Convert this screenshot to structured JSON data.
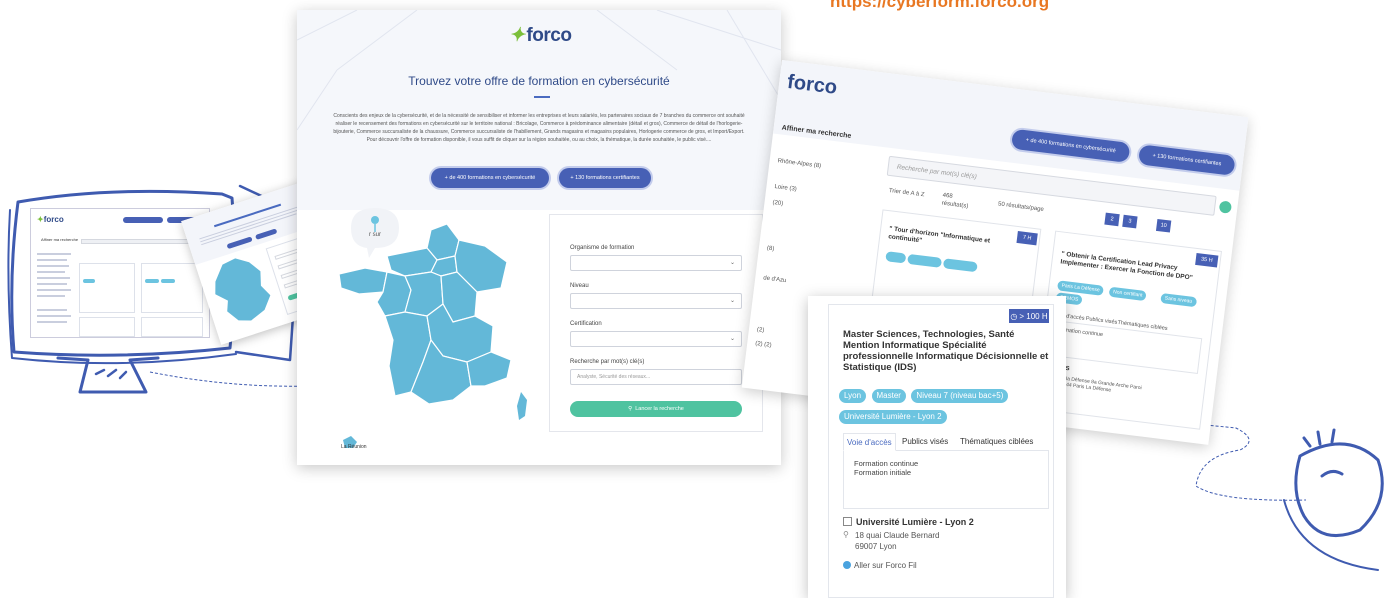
{
  "banner_url": "https://cyberform.forco.org",
  "brand": {
    "logo": "forco",
    "accent": "#4760b5",
    "tag_color": "#6cc4e0",
    "go_color": "#4fc3a0",
    "url_color": "#e87722"
  },
  "main_page": {
    "title": "Trouvez votre offre de formation en cybersécurité",
    "intro": "Conscients des enjeux de la cybersécurité, et de la nécessité de sensibiliser et informer les entreprises et leurs salariés, les partenaires sociaux de 7 branches du commerce ont souhaité réaliser le recensement des formations en cybersécurité sur le territoire national : Bricolage, Commerce à prédominance alimentaire (détail et gros), Commerce de détail de l'horlogerie-bijouterie, Commerce succursaliste de la chaussure, Commerce succursaliste de l'habillement, Grands magasins et magasins populaires, Horlogerie commerce de gros, et Import/Export. Pour découvrir l'offre de formation disponible, il vous suffit de cliquer sur la région souhaitée, ou au choix, la thématique, la durée souhaitée, le public visé....",
    "btn_formations": "+ de 400 formations en cybersécurité",
    "btn_certifiantes": "+ 130 formations certifiantes",
    "map_pin_text": "r sur",
    "map_region_label": "La Réunion",
    "search": {
      "organisme_label": "Organisme de formation",
      "niveau_label": "Niveau",
      "certification_label": "Certification",
      "keyword_label": "Recherche par mot(s) clé(s)",
      "keyword_placeholder": "Analyste, Sécurité des réseaux...",
      "submit_label": "Lancer la recherche"
    }
  },
  "results_page": {
    "logo": "forco",
    "affiner_label": "Affiner ma recherche",
    "search_placeholder": "Recherche par mot(s) clé(s)",
    "btn_formations": "+ de 400 formations en cybersécurité",
    "btn_certifiantes": "+ 130 formations certifiantes",
    "sort_label": "Trier de A à Z",
    "result_count": "468",
    "result_label": "résultat(s)",
    "per_page": "50 résultats/page",
    "pages": [
      "2",
      "3",
      "10"
    ],
    "facets": [
      "Rhône-Alpes (8)",
      "Loire (3)",
      "(20)",
      "(8)",
      "de d'Azu",
      "(2)",
      "(2) (2)"
    ],
    "card_left_title": "\" Tour d'horizon \"Informatique et continuité\"",
    "card_right_title": "\" Obtenir la Certification Lead Privacy Implementer : Exercer la Fonction de DPO\"",
    "card_right_duration": "35 H",
    "card_left_duration": "7 H",
    "card_right_tags": [
      "Paris La Défense",
      "Non certifiant",
      "Sans niveau",
      "DEMOS"
    ],
    "card_right_tabs": [
      "Voie d'accès",
      "Publics visés",
      "Thématiques ciblées"
    ],
    "card_right_access": "Formation continue",
    "card_right_org": "DEMOS",
    "card_right_addr": "Paris de la Défense 8a Grande Arche Paroi Nord 92044 Paris La Défense"
  },
  "detail_card": {
    "duration": "> 100 H",
    "title": "Master Sciences, Technologies, Santé Mention Informatique Spécialité professionnelle Informatique Décisionnelle et Statistique (IDS)",
    "tags": [
      "Lyon",
      "Master",
      "Niveau 7 (niveau bac+5)",
      "Université Lumière - Lyon 2"
    ],
    "tabs": [
      "Voie d'accès",
      "Publics visés",
      "Thématiques ciblées"
    ],
    "access_lines": [
      "Formation continue",
      "Formation initiale"
    ],
    "organisme": "Université Lumière - Lyon 2",
    "address_line1": "18 quai Claude Bernard",
    "address_line2": "69007 Lyon",
    "link_label": "Aller sur Forco Fil"
  },
  "mini_screens": {
    "monitor_logo": "forco",
    "monitor_sidebar_label": "Affiner ma recherche"
  }
}
